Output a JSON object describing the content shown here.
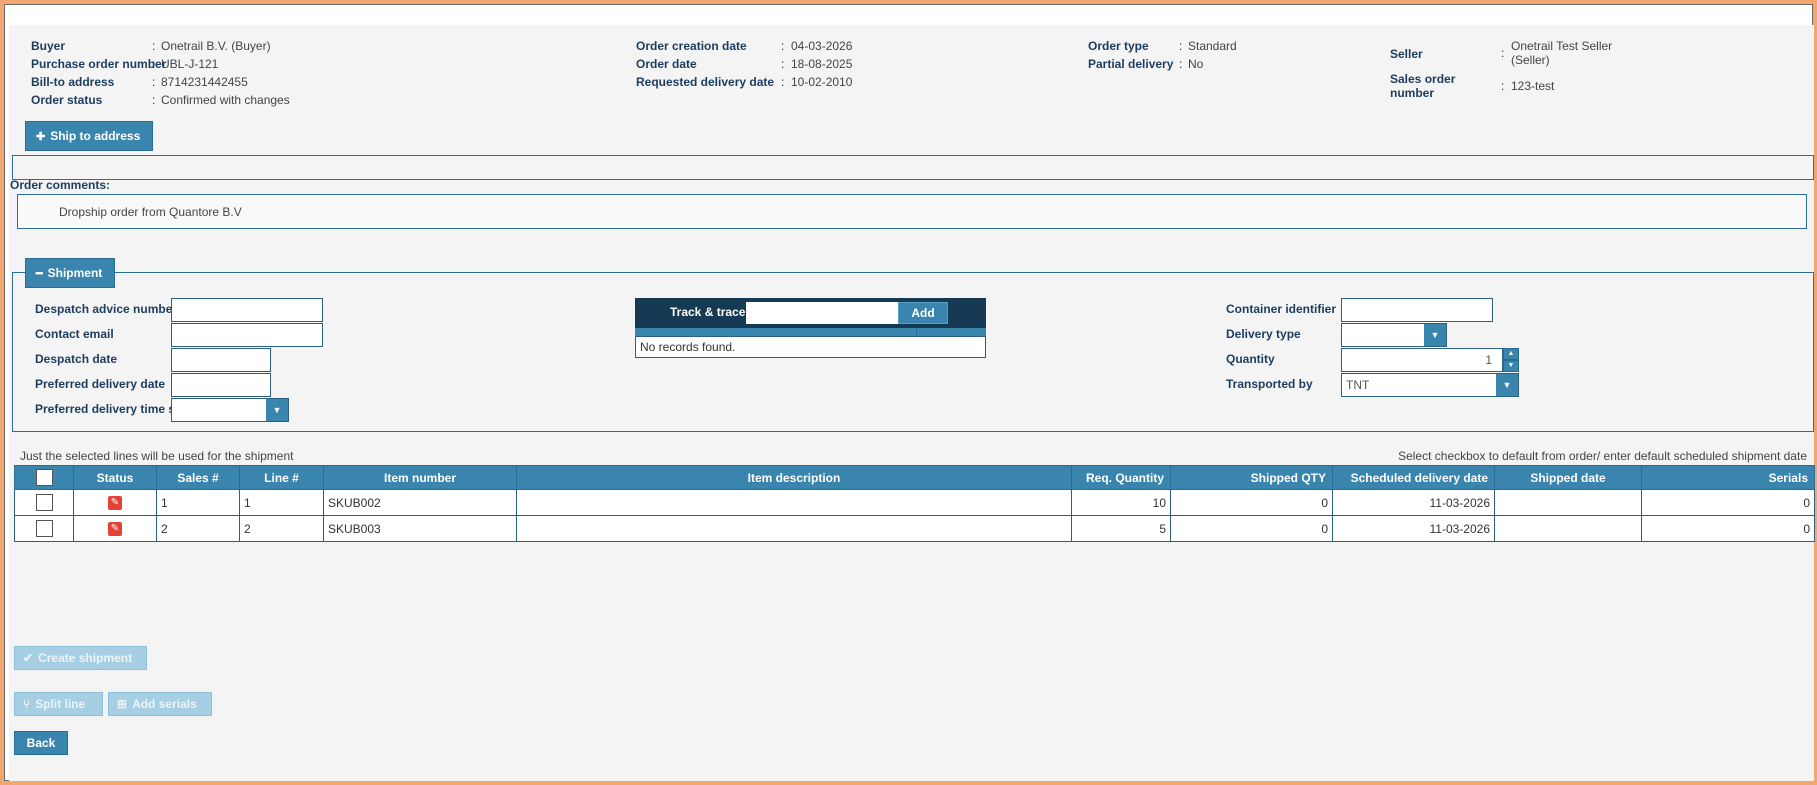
{
  "order_header": {
    "col1": [
      {
        "label": "Buyer",
        "value": "Onetrail B.V. (Buyer)"
      },
      {
        "label": "Purchase order number",
        "value": "UBL-J-121"
      },
      {
        "label": "Bill-to address",
        "value": "8714231442455"
      },
      {
        "label": "Order status",
        "value": "Confirmed with changes"
      }
    ],
    "col2": [
      {
        "label": "Order creation date",
        "value": "04-03-2026"
      },
      {
        "label": "Order date",
        "value": "18-08-2025"
      },
      {
        "label": "Requested delivery date",
        "value": "10-02-2010"
      }
    ],
    "col3": [
      {
        "label": "Order type",
        "value": "Standard"
      },
      {
        "label": "Partial delivery",
        "value": "No"
      }
    ],
    "col4": [
      {
        "label": "Seller",
        "value_line1": "Onetrail Test Seller",
        "value_line2": "(Seller)"
      },
      {
        "label_line1": "Sales order",
        "label_line2": "number",
        "value": "123-test"
      }
    ]
  },
  "ship_to": {
    "label": "Ship to address",
    "icon": "plus-icon"
  },
  "comments": {
    "label": "Order comments:",
    "text": "Dropship order from Quantore B.V"
  },
  "shipment": {
    "label": "Shipment",
    "icon": "minus-icon",
    "fields": {
      "despatch_advice_number": {
        "label": "Despatch advice number",
        "value": ""
      },
      "contact_email": {
        "label": "Contact email",
        "value": ""
      },
      "despatch_date": {
        "label": "Despatch date",
        "value": ""
      },
      "preferred_delivery_date": {
        "label": "Preferred delivery date",
        "value": ""
      },
      "preferred_delivery_time_slot": {
        "label": "Preferred delivery time slot",
        "value": ""
      },
      "container_identifier": {
        "label": "Container identifier",
        "value": ""
      },
      "delivery_type": {
        "label": "Delivery type",
        "value": ""
      },
      "quantity": {
        "label": "Quantity",
        "value": "1"
      },
      "transported_by": {
        "label": "Transported by",
        "value": "TNT"
      }
    },
    "track_trace": {
      "label": "Track & trace",
      "value": "",
      "add_label": "Add",
      "empty_text": "No records found."
    }
  },
  "table_notes": {
    "left": "Just the selected lines will be used for the shipment",
    "right": "Select checkbox to default from order/ enter default scheduled shipment date"
  },
  "table": {
    "columns": [
      "Status",
      "Sales #",
      "Line #",
      "Item number",
      "Item description",
      "Req. Quantity",
      "Shipped QTY",
      "Scheduled delivery date",
      "Shipped date",
      "Serials"
    ],
    "rows": [
      {
        "sales": "1",
        "line": "1",
        "item_number": "SKUB002",
        "item_description": "",
        "req_quantity": "10",
        "shipped_qty": "0",
        "scheduled_delivery_date": "11-03-2026",
        "shipped_date": "",
        "serials": "0"
      },
      {
        "sales": "2",
        "line": "2",
        "item_number": "SKUB003",
        "item_description": "",
        "req_quantity": "5",
        "shipped_qty": "0",
        "scheduled_delivery_date": "11-03-2026",
        "shipped_date": "",
        "serials": "0"
      }
    ]
  },
  "actions": {
    "create_shipment": "Create shipment",
    "split_line": "Split line",
    "add_serials": "Add serials",
    "back": "Back"
  },
  "colors": {
    "accent": "#3a85ad",
    "dark": "#163a54",
    "label": "#1c3d5e",
    "edit": "#e54236",
    "frame": "#f0a870"
  }
}
